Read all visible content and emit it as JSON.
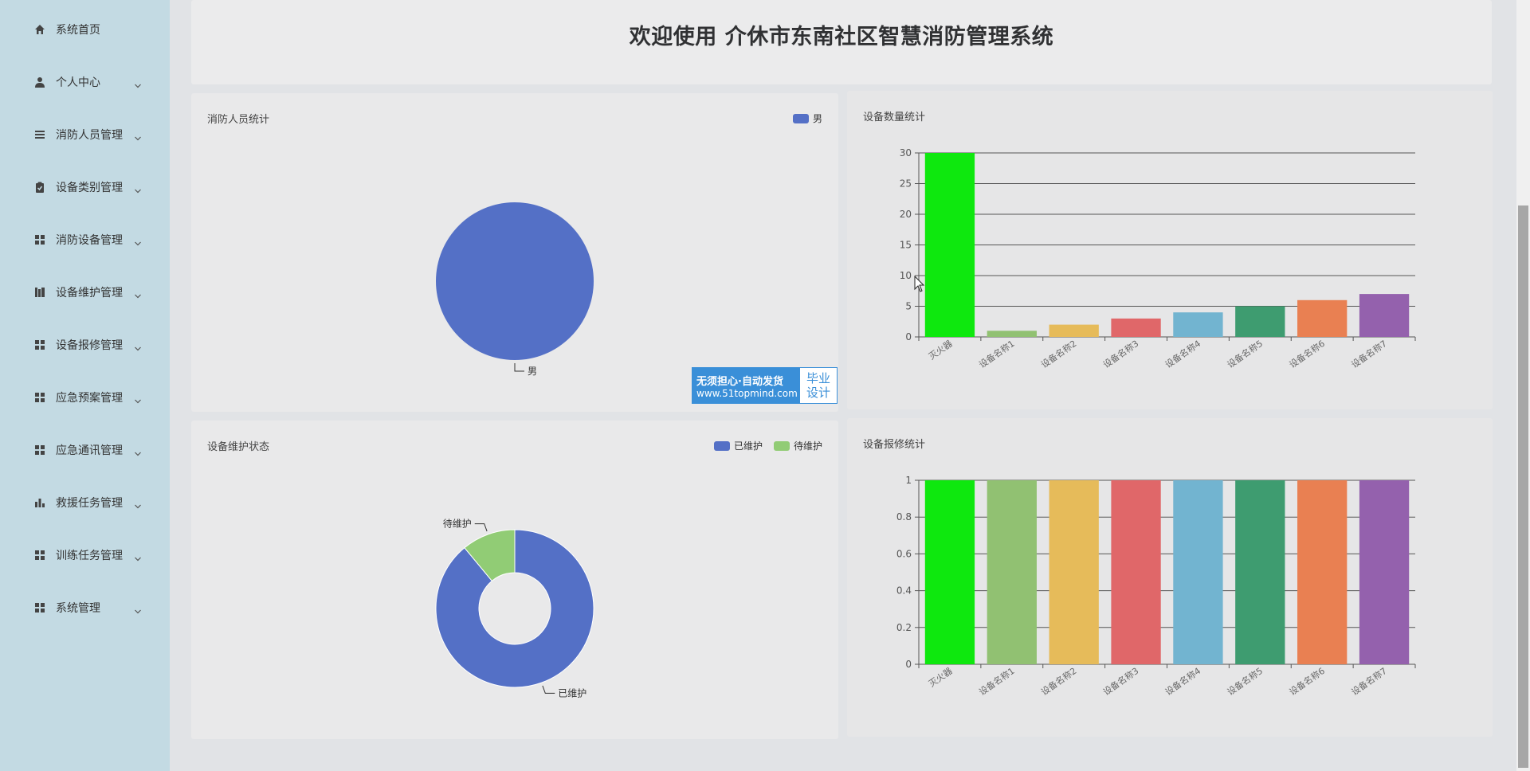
{
  "sidebar": {
    "items": [
      {
        "label": "系统首页",
        "icon": "home-icon",
        "has_children": false
      },
      {
        "label": "个人中心",
        "icon": "user-icon",
        "has_children": true
      },
      {
        "label": "消防人员管理",
        "icon": "list-icon",
        "has_children": true
      },
      {
        "label": "设备类别管理",
        "icon": "clipboard-icon",
        "has_children": true
      },
      {
        "label": "消防设备管理",
        "icon": "grid-icon",
        "has_children": true
      },
      {
        "label": "设备维护管理",
        "icon": "book-icon",
        "has_children": true
      },
      {
        "label": "设备报修管理",
        "icon": "grid-icon",
        "has_children": true
      },
      {
        "label": "应急预案管理",
        "icon": "grid-icon",
        "has_children": true
      },
      {
        "label": "应急通讯管理",
        "icon": "grid-icon",
        "has_children": true
      },
      {
        "label": "救援任务管理",
        "icon": "bar-chart-icon",
        "has_children": true
      },
      {
        "label": "训练任务管理",
        "icon": "grid-icon",
        "has_children": true
      },
      {
        "label": "系统管理",
        "icon": "grid-icon",
        "has_children": true
      }
    ]
  },
  "header": {
    "title": "欢迎使用 介休市东南社区智慧消防管理系统"
  },
  "badge": {
    "line1": "无须担心·自动发货",
    "line2": "www.51topmind.com",
    "right1": "毕业",
    "right2": "设计"
  },
  "colors": {
    "sidebar_bg": "#c3dae3",
    "pie_blue": "#5470c6",
    "pie_green": "#91cc75",
    "bars": [
      "#0ee80e",
      "#91c172",
      "#e6bb5a",
      "#e06769",
      "#72b4d0",
      "#3e9c70",
      "#e98052",
      "#9461ad"
    ]
  },
  "chart_data": [
    {
      "type": "pie",
      "title": "消防人员统计",
      "legend": [
        "男"
      ],
      "legend_position": "top-right",
      "slices": [
        {
          "name": "男",
          "value": 1
        }
      ]
    },
    {
      "type": "bar",
      "title": "设备数量统计",
      "categories": [
        "灭火器",
        "设备名称1",
        "设备名称2",
        "设备名称3",
        "设备名称4",
        "设备名称5",
        "设备名称6",
        "设备名称7"
      ],
      "values": [
        30,
        1,
        2,
        3,
        4,
        5,
        6,
        7
      ],
      "ylim": [
        0,
        30
      ],
      "yticks": [
        "0",
        "5",
        "10",
        "15",
        "20",
        "25",
        "30"
      ],
      "grid": true
    },
    {
      "type": "pie",
      "variant": "donut",
      "title": "设备维护状态",
      "legend": [
        "已维护",
        "待维护"
      ],
      "legend_position": "top-right",
      "slices": [
        {
          "name": "已维护",
          "value": 89
        },
        {
          "name": "待维护",
          "value": 11
        }
      ]
    },
    {
      "type": "bar",
      "title": "设备报修统计",
      "categories": [
        "灭火器",
        "设备名称1",
        "设备名称2",
        "设备名称3",
        "设备名称4",
        "设备名称5",
        "设备名称6",
        "设备名称7"
      ],
      "values": [
        1,
        1,
        1,
        1,
        1,
        1,
        1,
        1
      ],
      "ylim": [
        0,
        1
      ],
      "yticks": [
        "0",
        "0.2",
        "0.4",
        "0.6",
        "0.8",
        "1"
      ],
      "grid": true
    }
  ]
}
